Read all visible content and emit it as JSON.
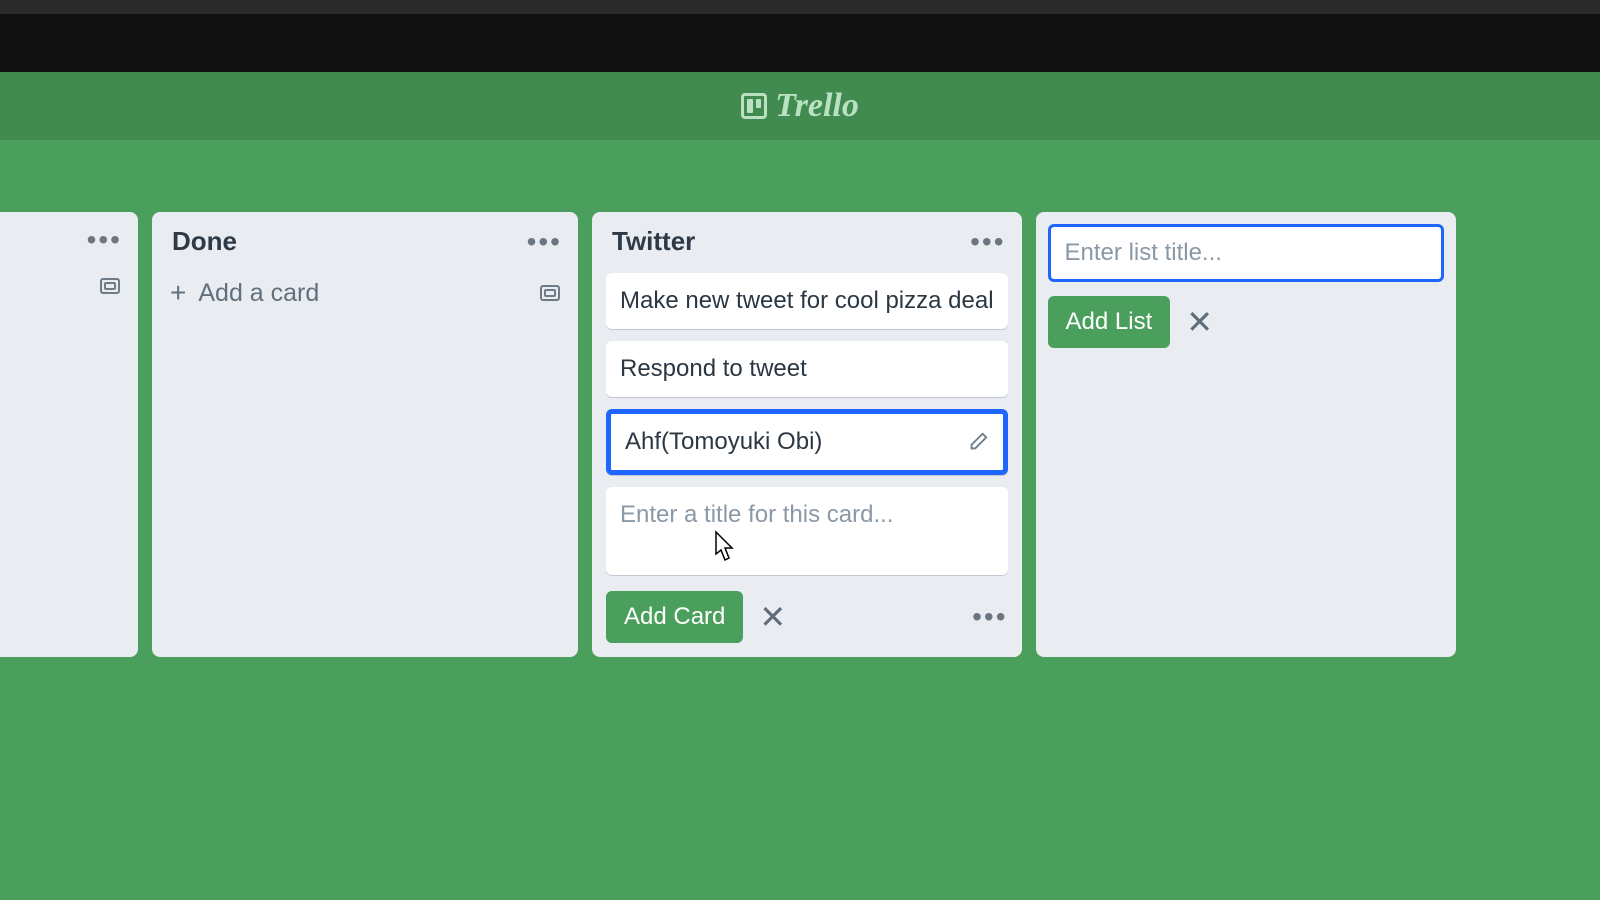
{
  "brand": "Trello",
  "lists": {
    "partial": {},
    "done": {
      "title": "Done",
      "add_card_label": "Add a card"
    },
    "twitter": {
      "title": "Twitter",
      "cards": [
        "Make new tweet for cool pizza deal",
        "Respond to tweet",
        "Ahf(Tomoyuki Obi)"
      ],
      "composer_placeholder": "Enter a title for this card...",
      "add_card_button": "Add Card"
    }
  },
  "add_list": {
    "placeholder": "Enter list title...",
    "button": "Add List"
  }
}
